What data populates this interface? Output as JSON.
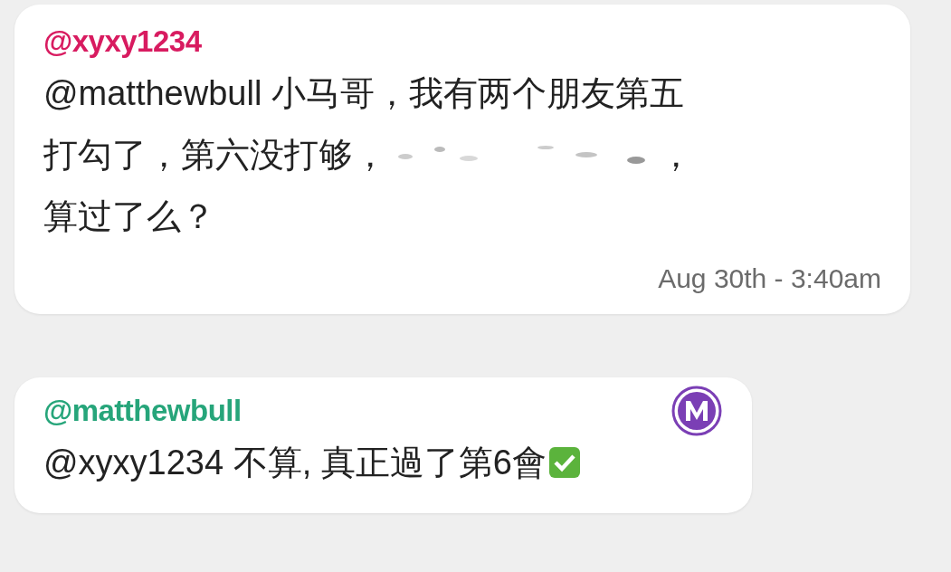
{
  "messages": [
    {
      "username": "@xyxy1234",
      "color": "#d81b60",
      "lines": [
        {
          "text": "@matthewbull 小马哥，我有两个朋友第五",
          "redacted": false
        },
        {
          "text": "打勾了，第六没打够，",
          "redacted": true,
          "after": "，"
        },
        {
          "text": "算过了么？",
          "redacted": false
        }
      ],
      "time": "Aug 30th - 3:40am",
      "badge": false
    },
    {
      "username": "@matthewbull",
      "color": "#26a57a",
      "lines": [
        {
          "text": "@xyxy1234 不算, 真正過了第6會",
          "redacted": false,
          "check": true
        }
      ],
      "badge": true
    }
  ]
}
